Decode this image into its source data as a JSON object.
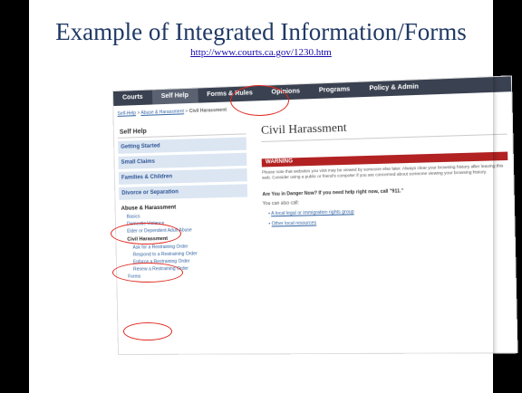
{
  "slide": {
    "title": "Example of Integrated Information/Forms",
    "url": "http://www.courts.ca.gov/1230.htm"
  },
  "screenshot": {
    "nav": [
      "Courts",
      "Self Help",
      "Forms & Rules",
      "Opinions",
      "Programs",
      "Policy & Admin"
    ],
    "breadcrumb": {
      "link1": "Self-Help",
      "link2": "Abuse & Harassment",
      "current": "Civil Harassment"
    },
    "sidebar": {
      "heading": "Self Help",
      "blocks": [
        "Getting Started",
        "Small Claims",
        "Families & Children",
        "Divorce or Separation"
      ],
      "section": "Abuse & Harassment",
      "subitems": [
        "Basics",
        "Domestic Violence",
        "Elder or Dependent Adult Abuse"
      ],
      "active": "Civil Harassment",
      "active_children": [
        "Ask for a Restraining Order",
        "Respond to a Restraining Order",
        "Enforce a Restraining Order",
        "Renew a Restraining Order",
        "Forms"
      ]
    },
    "main": {
      "title": "Civil Harassment",
      "warning_label": "WARNING",
      "warning_text": "Please note that websites you visit may be viewed by someone else later. Always clear your browsing history after leaving this web. Consider using a public or friend's computer if you are concerned about someone viewing your browsing history.",
      "danger_text": "Are You in Danger Now? If you need help right now, call \"911.\"",
      "can_call": "You can also call:",
      "link1": "A local legal or immigration rights group",
      "link2": "Other local resources"
    }
  }
}
